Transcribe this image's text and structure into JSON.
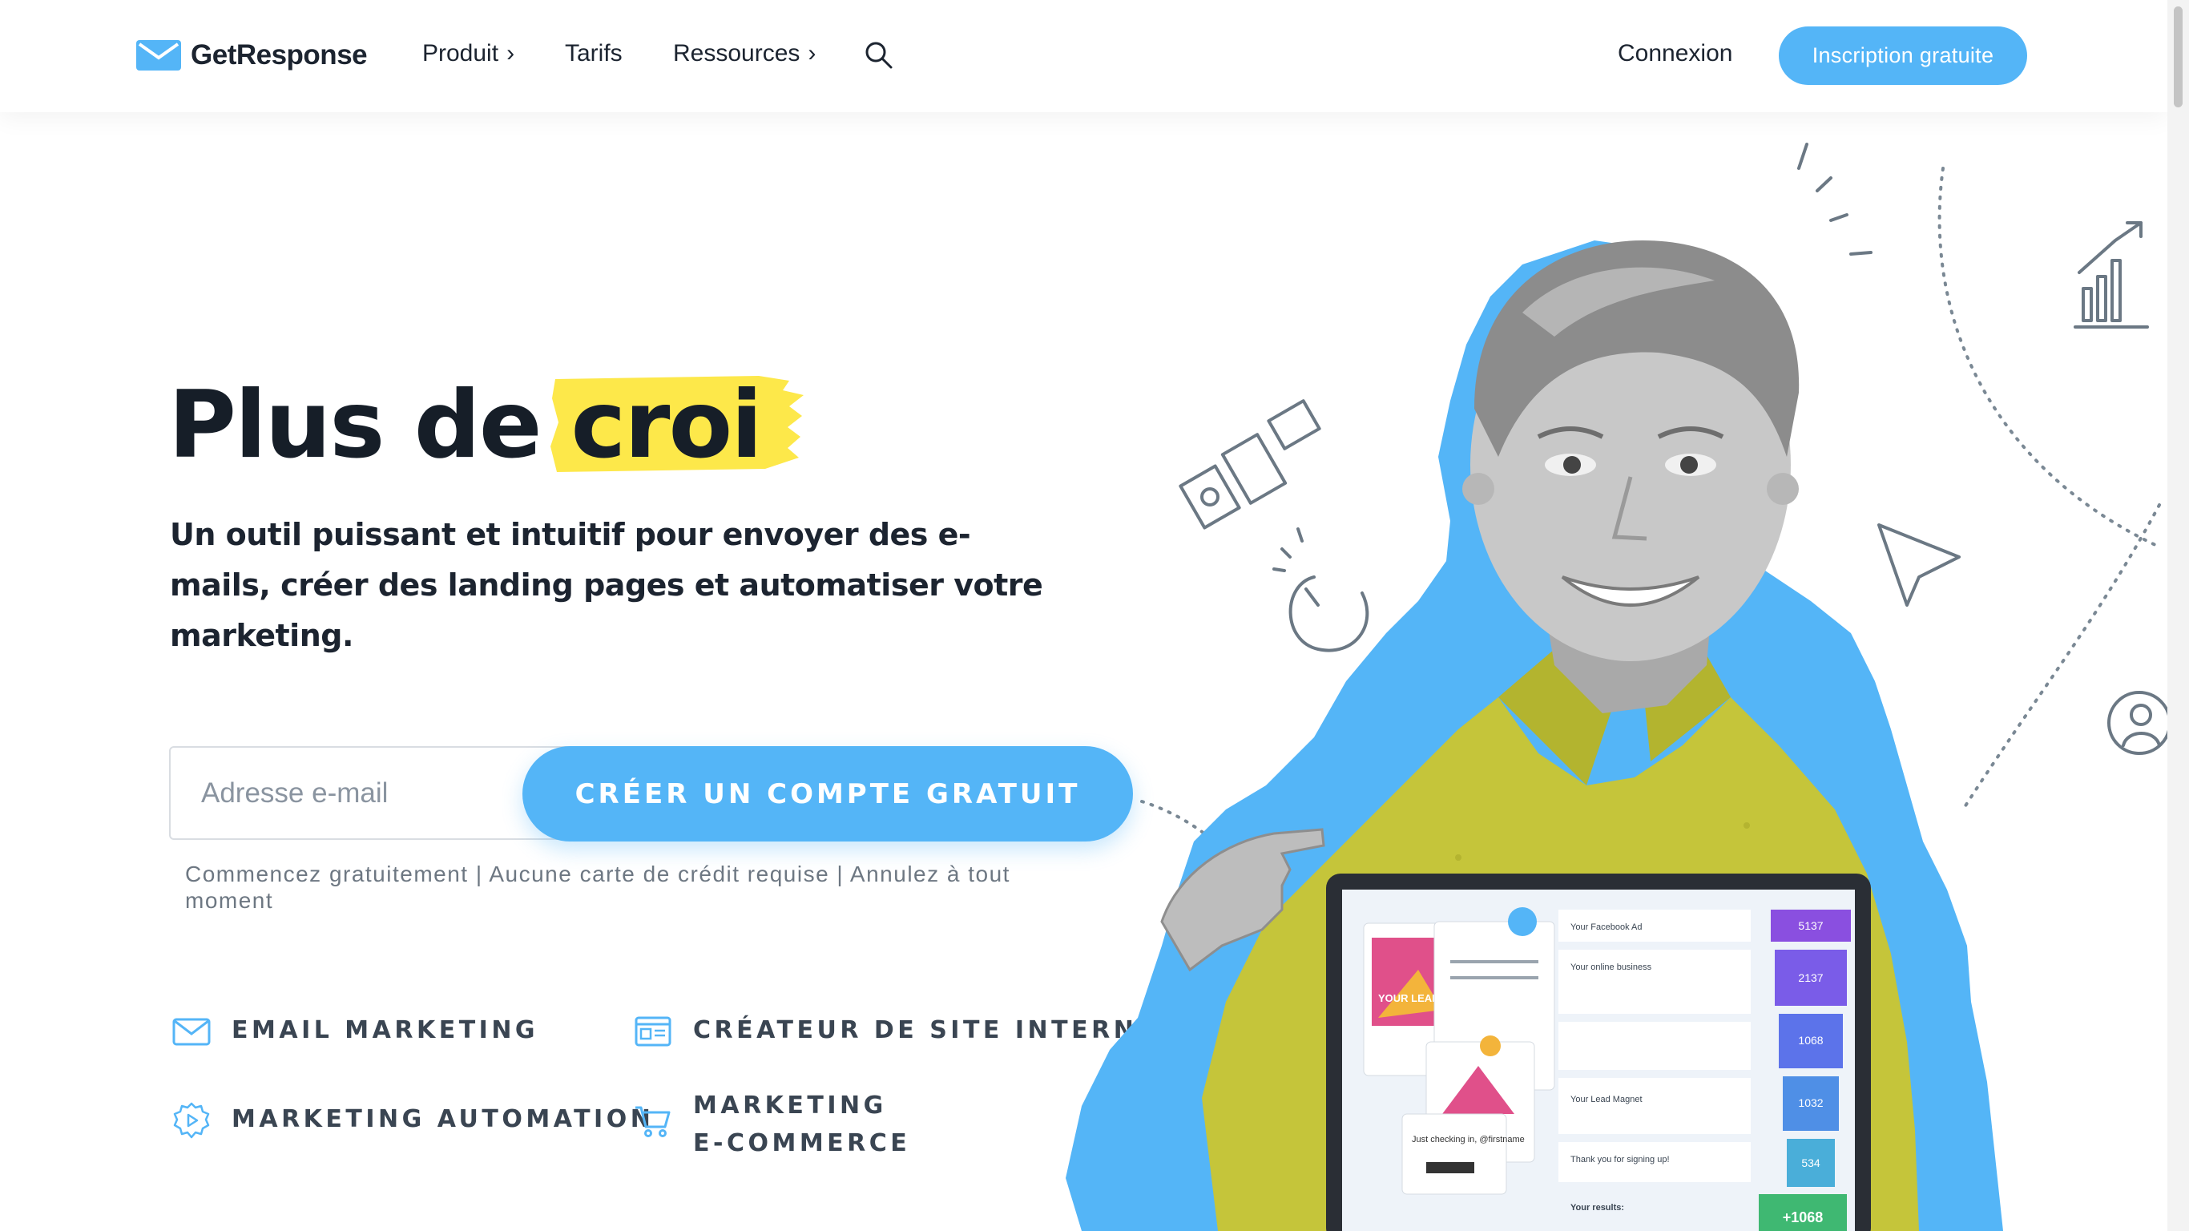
{
  "header": {
    "brand": "GetResponse",
    "nav": [
      {
        "label": "Produit",
        "chevron": "›"
      },
      {
        "label": "Tarifs"
      },
      {
        "label": "Ressources",
        "chevron": "›"
      }
    ],
    "login_label": "Connexion",
    "signup_label": "Inscription gratuite"
  },
  "hero": {
    "title_prefix": "Plus de",
    "title_highlight": "croi",
    "subtitle": "Un outil puissant et intuitif pour envoyer des e-mails, créer des landing pages et automatiser votre marketing.",
    "email_placeholder": "Adresse e-mail",
    "cta_label": "CRÉER UN COMPTE GRATUIT",
    "fine_print": "Commencez gratuitement | Aucune carte de crédit requise | Annulez à tout moment"
  },
  "features": [
    {
      "label": "EMAIL MARKETING",
      "icon": "envelope-icon"
    },
    {
      "label": "CRÉATEUR DE SITE INTERNET",
      "icon": "website-builder-icon"
    },
    {
      "label": "MARKETING AUTOMATION",
      "icon": "automation-gear-icon"
    },
    {
      "label": "MARKETING\nE-COMMERCE",
      "icon": "shopping-cart-icon"
    }
  ],
  "laptop": {
    "funnel": [
      "5137",
      "2137",
      "1068",
      "1032",
      "534"
    ],
    "growth": "+1068",
    "rows": [
      "Your Facebook Ad",
      "Your online business",
      "Your Lead Magnet",
      "Thank you for signing up!"
    ],
    "results_label": "Your results:",
    "lead_magnet_text": "YOUR LEAD MAGNET",
    "checking_text": "Just checking in, @firstname"
  },
  "colors": {
    "accent_blue": "#54b5f7",
    "highlight_yellow": "#fde84a",
    "text_dark": "#161e28"
  }
}
